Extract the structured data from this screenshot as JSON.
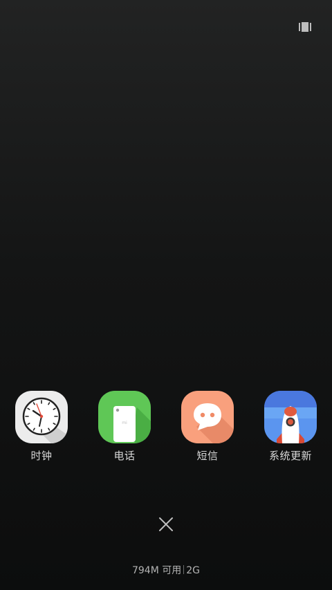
{
  "toolbar": {
    "view_toggle_icon": "card-view-icon"
  },
  "recent_apps": [
    {
      "label": "时钟",
      "icon": "clock-icon",
      "color": "#e8e8e8"
    },
    {
      "label": "电话",
      "icon": "phone-icon",
      "color": "#5fc756"
    },
    {
      "label": "短信",
      "icon": "message-icon",
      "color": "#f9a07d"
    },
    {
      "label": "系统更新",
      "icon": "system-update-icon",
      "color": "#4f84e6"
    }
  ],
  "clear_button": {
    "icon": "close-icon"
  },
  "memory": {
    "available": "794M 可用",
    "total": "2G"
  }
}
